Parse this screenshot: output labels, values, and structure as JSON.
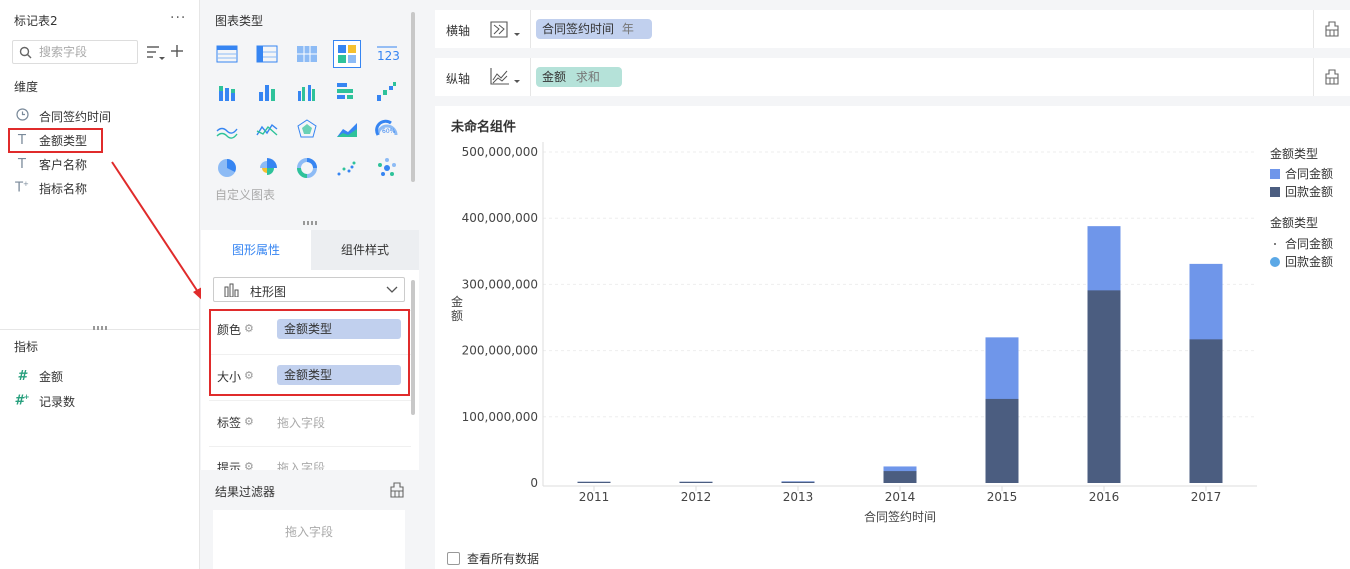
{
  "left": {
    "title": "标记表2",
    "more": "···",
    "search_placeholder": "搜索字段",
    "dimensions_label": "维度",
    "dimensions": [
      {
        "icon": "clock-icon",
        "label": "合同签约时间"
      },
      {
        "icon": "text-icon",
        "label": "金额类型"
      },
      {
        "icon": "text-icon",
        "label": "客户名称"
      },
      {
        "icon": "text-icon",
        "label": "指标名称"
      }
    ],
    "measures_label": "指标",
    "measures": [
      {
        "icon": "hash-icon",
        "label": "金额"
      },
      {
        "icon": "hash-icon",
        "label": "记录数"
      }
    ]
  },
  "mid": {
    "chart_types_label": "图表类型",
    "custom_chart_label": "自定义图表",
    "tabs": [
      "图形属性",
      "组件样式"
    ],
    "chart_select_value": "柱形图",
    "rows": [
      {
        "label": "颜色",
        "value": "金额类型"
      },
      {
        "label": "大小",
        "value": "金额类型"
      },
      {
        "label": "标签",
        "placeholder": "拖入字段"
      },
      {
        "label": "提示",
        "placeholder": "拖入字段"
      }
    ],
    "result_filter_label": "结果过滤器",
    "result_filter_placeholder": "拖入字段"
  },
  "axes": {
    "x_label": "横轴",
    "x_field": "合同签约时间",
    "x_field_suffix": "年",
    "y_label": "纵轴",
    "y_field": "金额",
    "y_field_suffix": "求和"
  },
  "chart_panel": {
    "title": "未命名组件",
    "view_all_label": "查看所有数据"
  },
  "colors": {
    "contract": "#6f96ea",
    "payment": "#4b5d80",
    "accent": "#3685f2",
    "highlight_red": "#e02b2b"
  },
  "chart_data": {
    "type": "bar",
    "title": "",
    "xlabel": "合同签约时间",
    "ylabel": "金额",
    "categories": [
      "2011",
      "2012",
      "2013",
      "2014",
      "2015",
      "2016",
      "2017"
    ],
    "y_ticks": [
      "0",
      "100,000,000",
      "200,000,000",
      "300,000,000",
      "400,000,000",
      "500,000,000"
    ],
    "ylim": [
      0,
      500000000
    ],
    "series": [
      {
        "name": "合同金额",
        "values": [
          800000,
          800000,
          2500000,
          25000000,
          220000000,
          388000000,
          331000000
        ]
      },
      {
        "name": "回款金额",
        "values": [
          500000,
          500000,
          1500000,
          18000000,
          127000000,
          291000000,
          217000000
        ]
      }
    ],
    "legend": [
      {
        "title": "金额类型",
        "items": [
          "合同金额",
          "回款金额"
        ]
      },
      {
        "title": "金额类型",
        "items": [
          "合同金额",
          "回款金额"
        ]
      }
    ],
    "legend_position": "right",
    "grid": true
  }
}
